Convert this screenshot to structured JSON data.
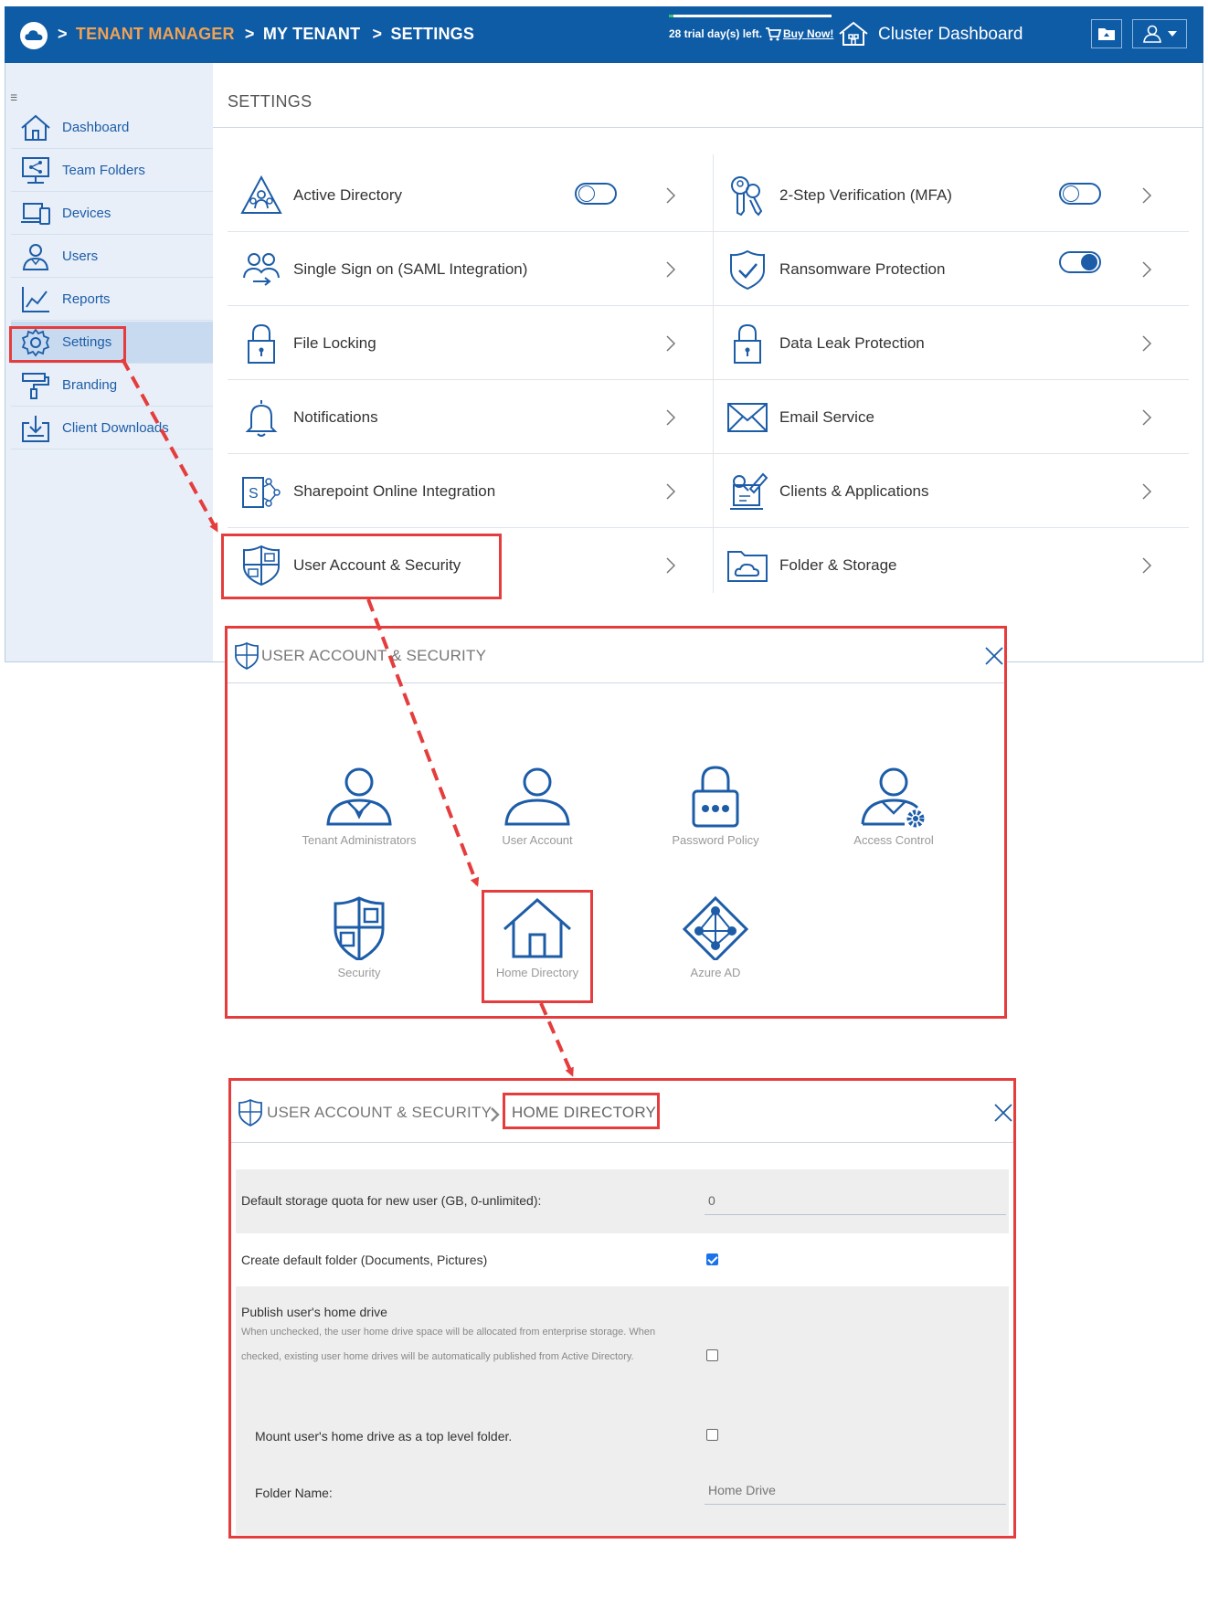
{
  "topbar": {
    "breadcrumb": [
      "TENANT MANAGER",
      "MY TENANT",
      "SETTINGS"
    ],
    "breadcrumb_sep": ">",
    "trial_text": "28 trial day(s) left.",
    "buy_now": "Buy Now!",
    "cluster_dashboard": "Cluster Dashboard",
    "trial_progress": 0.03
  },
  "sidebar": {
    "items": [
      {
        "label": "Dashboard",
        "icon": "home-icon"
      },
      {
        "label": "Team Folders",
        "icon": "team-folders-icon"
      },
      {
        "label": "Devices",
        "icon": "devices-icon"
      },
      {
        "label": "Users",
        "icon": "users-icon"
      },
      {
        "label": "Reports",
        "icon": "reports-icon"
      },
      {
        "label": "Settings",
        "icon": "gear-icon",
        "active": true
      },
      {
        "label": "Branding",
        "icon": "paint-roller-icon"
      },
      {
        "label": "Client Downloads",
        "icon": "download-icon"
      }
    ]
  },
  "settings": {
    "title": "SETTINGS",
    "left": [
      {
        "label": "Active Directory",
        "toggle": "off"
      },
      {
        "label": "Single Sign on (SAML Integration)"
      },
      {
        "label": "File Locking"
      },
      {
        "label": "Notifications"
      },
      {
        "label": "Sharepoint Online Integration"
      },
      {
        "label": "User Account & Security"
      }
    ],
    "right": [
      {
        "label": "2-Step Verification (MFA)",
        "toggle": "off"
      },
      {
        "label": "Ransomware Protection",
        "toggle": "on"
      },
      {
        "label": "Data Leak Protection"
      },
      {
        "label": "Email Service"
      },
      {
        "label": "Clients & Applications"
      },
      {
        "label": "Folder & Storage"
      }
    ]
  },
  "dialog1": {
    "title": "USER ACCOUNT & SECURITY",
    "tiles": [
      "Tenant Administrators",
      "User Account",
      "Password Policy",
      "Access Control",
      "Security",
      "Home Directory",
      "Azure AD"
    ]
  },
  "dialog2": {
    "crumb1": "USER ACCOUNT & SECURITY",
    "crumb2": "HOME DIRECTORY",
    "fields": {
      "quota_label": "Default storage quota for new user (GB, 0-unlimited):",
      "quota_value": "0",
      "create_folder_label": "Create default folder (Documents, Pictures)",
      "create_folder_checked": true,
      "publish_label": "Publish user's home drive",
      "publish_hint": "When unchecked, the user home drive space will be allocated from enterprise storage. When checked, existing user home drives will be automatically published from Active Directory.",
      "publish_checked": false,
      "mount_label": "Mount user's home drive as a top level folder.",
      "mount_checked": false,
      "folder_name_label": "Folder Name:",
      "folder_name_placeholder": "Home Drive"
    }
  },
  "colors": {
    "brand_blue": "#0e5ba6",
    "icon_blue": "#1d5da8",
    "breadcrumb_orange": "#f0a254",
    "highlight_red": "#e53d3d"
  }
}
